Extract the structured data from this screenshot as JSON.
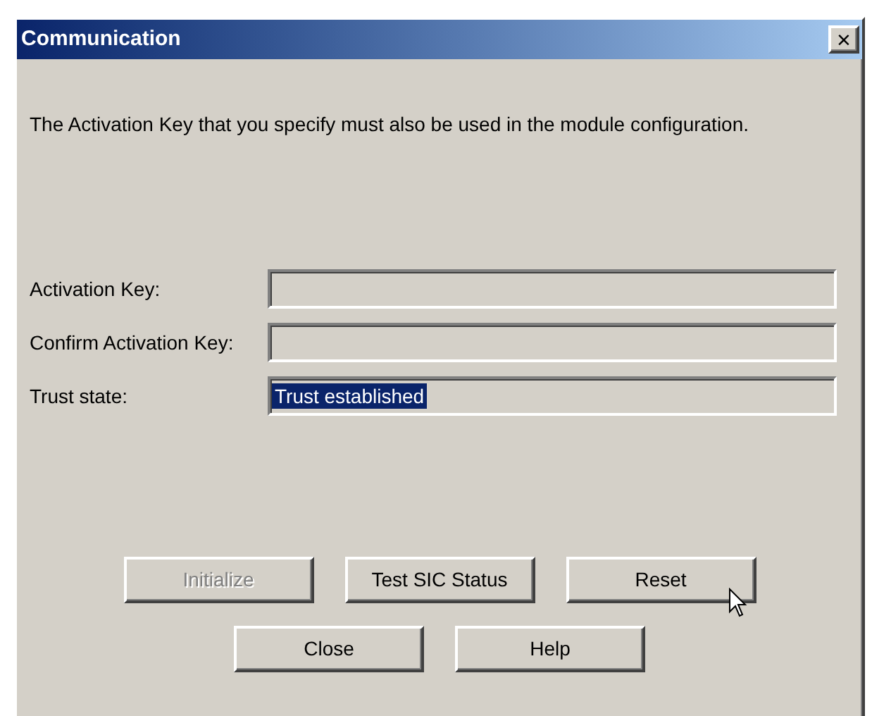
{
  "window": {
    "title": "Communication",
    "close_symbol": "×"
  },
  "message": "The Activation Key that you specify must also be used in the module configuration.",
  "fields": [
    {
      "label": "Activation Key:"
    },
    {
      "label": "Confirm Activation Key:"
    },
    {
      "label": "Trust state:",
      "value": "Trust established",
      "selected": true
    }
  ],
  "button_rows": [
    [
      {
        "label": "Initialize",
        "disabled": true
      },
      {
        "label": "Test SIC Status",
        "disabled": false
      },
      {
        "label": "Reset",
        "disabled": false,
        "hovered": true
      }
    ],
    [
      {
        "label": "Close",
        "disabled": false
      },
      {
        "label": "Help",
        "disabled": false
      }
    ]
  ]
}
